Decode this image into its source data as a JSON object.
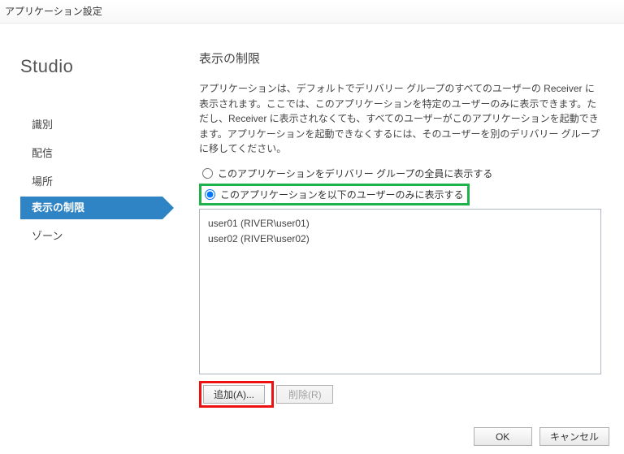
{
  "window": {
    "title": "アプリケーション設定"
  },
  "sidebar": {
    "studio": "Studio",
    "items": [
      {
        "label": "識別",
        "key": "identify"
      },
      {
        "label": "配信",
        "key": "delivery"
      },
      {
        "label": "場所",
        "key": "location"
      },
      {
        "label": "表示の制限",
        "key": "visibility",
        "selected": true
      },
      {
        "label": "ゾーン",
        "key": "zone"
      }
    ]
  },
  "main": {
    "heading": "表示の制限",
    "description": "アプリケーションは、デフォルトでデリバリー グループのすべてのユーザーの Receiver に表示されます。ここでは、このアプリケーションを特定のユーザーのみに表示できます。ただし、Receiver に表示されなくても、すべてのユーザーがこのアプリケーションを起動できます。アプリケーションを起動できなくするには、そのユーザーを別のデリバリー グループに移してください。",
    "radio_all": "このアプリケーションをデリバリー グループの全員に表示する",
    "radio_limited": "このアプリケーションを以下のユーザーのみに表示する",
    "users": [
      "user01 (RIVER\\user01)",
      "user02 (RIVER\\user02)"
    ],
    "add_button": "追加(A)...",
    "remove_button": "削除(R)"
  },
  "footer": {
    "ok": "OK",
    "cancel": "キャンセル"
  }
}
